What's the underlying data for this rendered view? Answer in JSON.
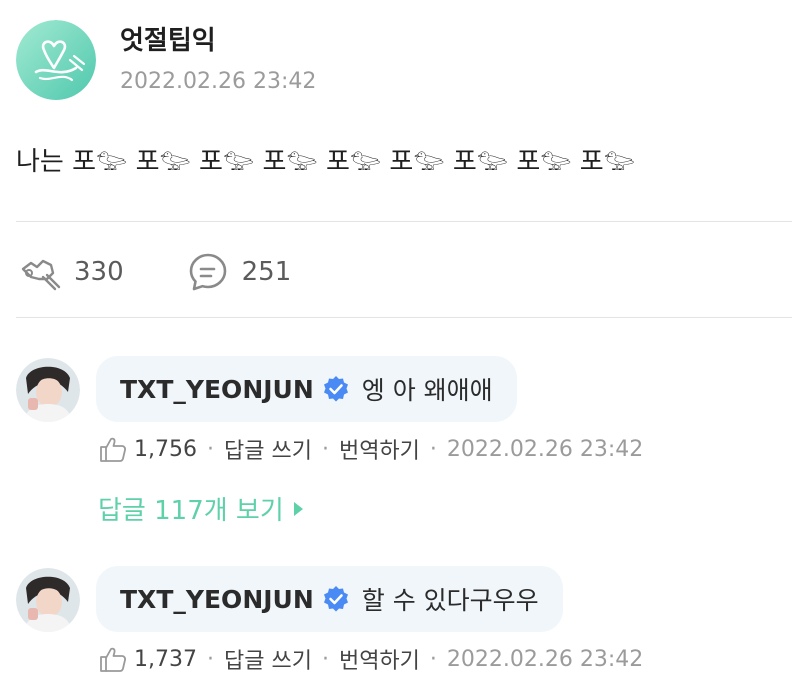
{
  "post": {
    "author": "엇절팁익",
    "timestamp": "2022.02.26 23:42",
    "body": "나는 포𓅰 포𓅰 포𓅰 포𓅰 포𓅰 포𓅰 포𓅰 포𓅰 포𓅰",
    "avatar_icon": "artist-heart-logo-icon",
    "avatar_colors": [
      "#8fe3c8",
      "#5ccdb2"
    ]
  },
  "actions": {
    "cheer_count": "330",
    "comment_count": "251",
    "cheer_icon": "cheer-hand-icon",
    "comment_icon": "comment-bubble-icon"
  },
  "comments": [
    {
      "user": "TXT_YEONJUN",
      "text": "엥 아 왜애애",
      "likes": "1,756",
      "reply_label": "답글 쓰기",
      "translate_label": "번역하기",
      "timestamp": "2022.02.26 23:42",
      "view_replies": "답글 117개 보기"
    },
    {
      "user": "TXT_YEONJUN",
      "text": "할 수 있다구우우",
      "likes": "1,737",
      "reply_label": "답글 쓰기",
      "translate_label": "번역하기",
      "timestamp": "2022.02.26 23:42"
    }
  ],
  "colors": {
    "accent": "#5fd1a9",
    "verified": "#4a8af4",
    "bubble": "#f0f6fa",
    "muted": "#9b9b9b"
  }
}
